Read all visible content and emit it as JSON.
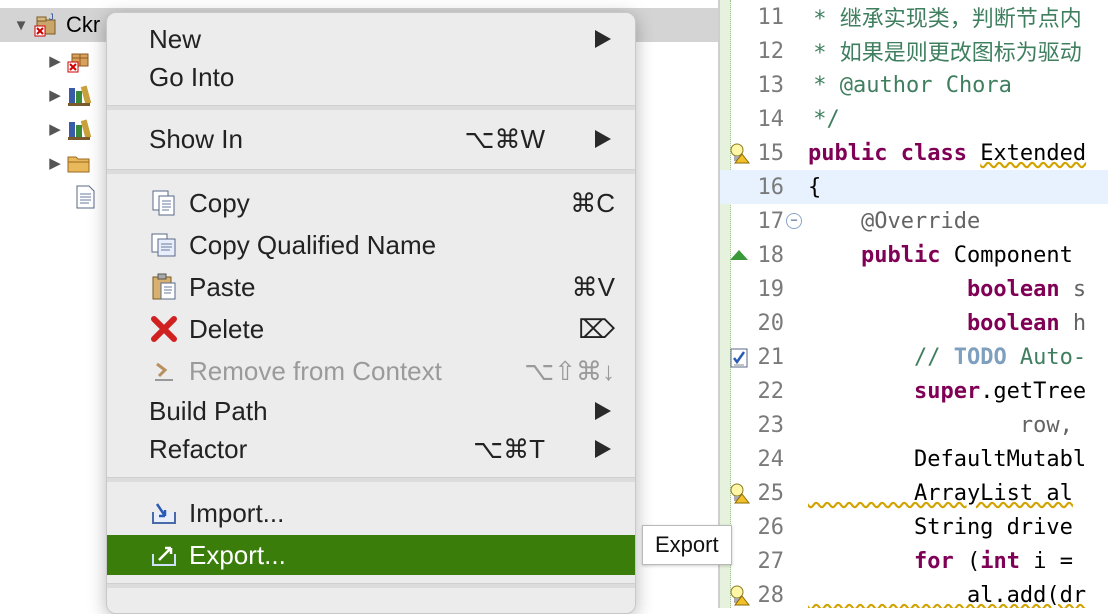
{
  "project_tree": {
    "project_label": "Ckr",
    "rows": [
      {
        "icon": "package-error-icon"
      },
      {
        "icon": "library-icon"
      },
      {
        "icon": "library-icon"
      },
      {
        "icon": "folder-icon"
      },
      {
        "icon": "file-icon"
      }
    ]
  },
  "context_menu": {
    "items": [
      {
        "id": "new",
        "label": "New",
        "shortcut": "",
        "submenu": true
      },
      {
        "id": "go-into",
        "label": "Go Into",
        "shortcut": "",
        "submenu": false
      },
      {
        "id": "show-in",
        "label": "Show In",
        "shortcut": "⌥⌘W",
        "submenu": true
      },
      {
        "id": "copy",
        "label": "Copy",
        "shortcut": "⌘C",
        "icon": "copy-icon"
      },
      {
        "id": "copy-qualified-name",
        "label": "Copy Qualified Name",
        "shortcut": "",
        "icon": "copy-qualified-icon"
      },
      {
        "id": "paste",
        "label": "Paste",
        "shortcut": "⌘V",
        "icon": "paste-icon"
      },
      {
        "id": "delete",
        "label": "Delete",
        "shortcut": "⌦",
        "icon": "delete-icon"
      },
      {
        "id": "remove-from-context",
        "label": "Remove from Context",
        "shortcut": "⌥⇧⌘↓",
        "icon": "remove-context-icon",
        "disabled": true
      },
      {
        "id": "build-path",
        "label": "Build Path",
        "shortcut": "",
        "submenu": true
      },
      {
        "id": "refactor",
        "label": "Refactor",
        "shortcut": "⌥⌘T",
        "submenu": true
      },
      {
        "id": "import",
        "label": "Import...",
        "shortcut": "",
        "icon": "import-icon"
      },
      {
        "id": "export",
        "label": "Export...",
        "shortcut": "",
        "icon": "export-icon",
        "highlighted": true
      }
    ]
  },
  "tooltip": {
    "text": "Export"
  },
  "editor": {
    "lines": [
      {
        "n": "11",
        "text": " * 继承实现类，判断节点内"
      },
      {
        "n": "12",
        "text": " * 如果是则更改图标为驱动"
      },
      {
        "n": "13",
        "text": " * @author Chora"
      },
      {
        "n": "14",
        "text": " */"
      },
      {
        "n": "15",
        "kw": "public class ",
        "rest": "Extended"
      },
      {
        "n": "16",
        "text": "{"
      },
      {
        "n": "17",
        "text": "    @Override"
      },
      {
        "n": "18",
        "kw": "    public ",
        "rest": "Component "
      },
      {
        "n": "19",
        "kw": "            boolean ",
        "rest": "s"
      },
      {
        "n": "20",
        "kw": "            boolean ",
        "rest": "h"
      },
      {
        "n": "21",
        "pre": "        // ",
        "todo": "TODO",
        "rest": " Auto-"
      },
      {
        "n": "22",
        "kw": "        super",
        "rest": ".getTree"
      },
      {
        "n": "23",
        "text": "                row,"
      },
      {
        "n": "24",
        "text": "        DefaultMutabl"
      },
      {
        "n": "25",
        "text": "        ArrayList al"
      },
      {
        "n": "26",
        "text": "        String drive"
      },
      {
        "n": "27",
        "kw": "        for ",
        "mid": "(",
        "kw2": "int",
        "rest": " i ="
      },
      {
        "n": "28",
        "text": "            al.add(dr"
      }
    ]
  }
}
